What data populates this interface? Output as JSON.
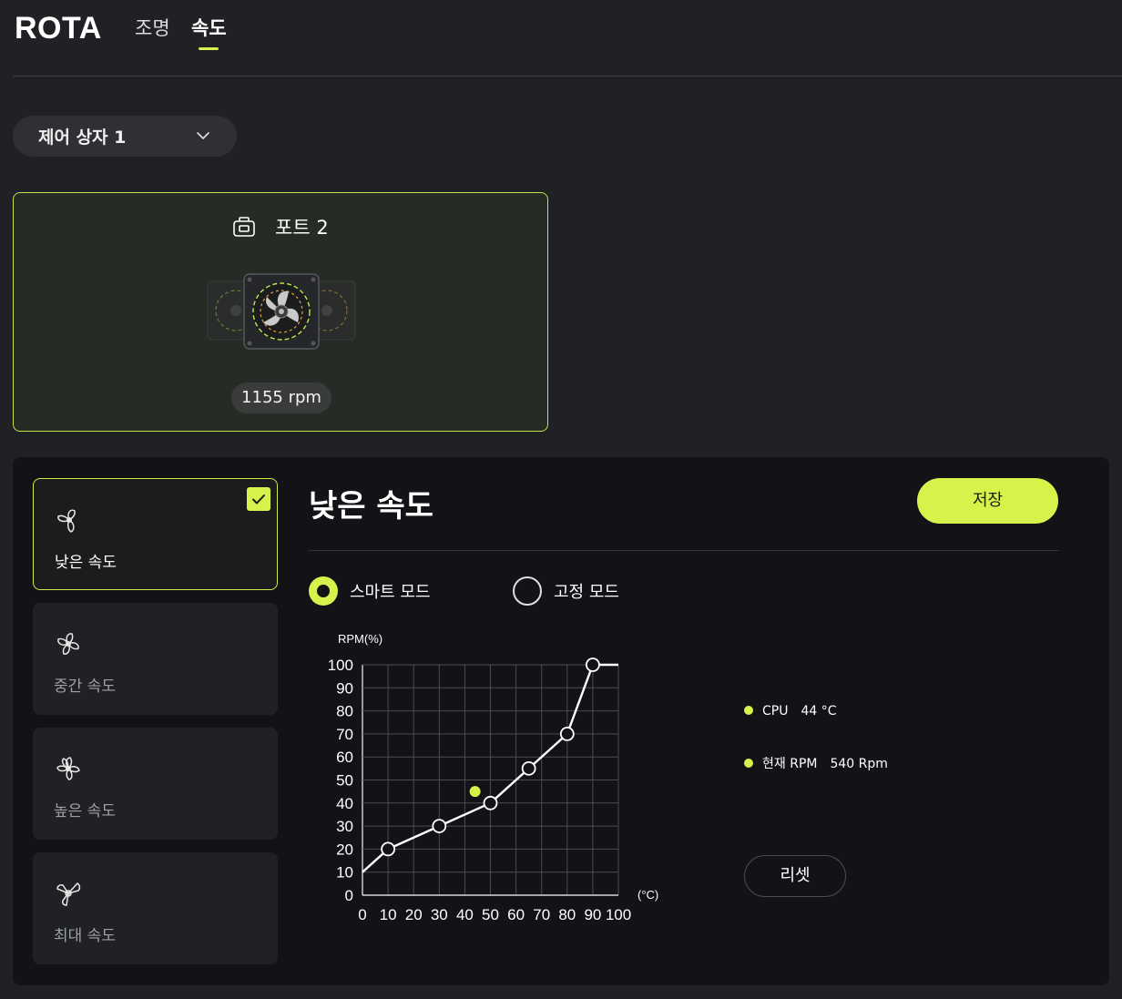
{
  "header": {
    "logo": "ROTA",
    "tabs": [
      {
        "label": "조명",
        "active": false
      },
      {
        "label": "속도",
        "active": true
      }
    ]
  },
  "controller_select": {
    "value": "제어 상자 1"
  },
  "port_card": {
    "title": "포트 2",
    "rpm": "1155 rpm"
  },
  "modes": [
    {
      "label": "낮은 속도",
      "selected": true,
      "icon": "fan-low-icon"
    },
    {
      "label": "중간 속도",
      "selected": false,
      "icon": "fan-medium-icon"
    },
    {
      "label": "높은 속도",
      "selected": false,
      "icon": "fan-high-icon"
    },
    {
      "label": "최대 속도",
      "selected": false,
      "icon": "fan-max-icon"
    }
  ],
  "detail": {
    "title": "낮은 속도",
    "save_label": "저장",
    "smart_mode_label": "스마트 모드",
    "fixed_mode_label": "고정 모드",
    "reset_label": "리셋"
  },
  "legend": {
    "cpu_label": "CPU",
    "cpu_value": "44 °C",
    "rpm_label": "현재 RPM",
    "rpm_value": "540 Rpm"
  },
  "colors": {
    "accent": "#d9f24b",
    "background": "#1f2124",
    "panel": "#111316"
  },
  "chart_data": {
    "type": "line",
    "ylabel": "RPM(%)",
    "xlabel": "(°C)",
    "x_ticks": [
      0,
      10,
      20,
      30,
      40,
      50,
      60,
      70,
      80,
      90,
      100
    ],
    "y_ticks": [
      0,
      10,
      20,
      30,
      40,
      50,
      60,
      70,
      80,
      90,
      100
    ],
    "xlim": [
      0,
      100
    ],
    "ylim": [
      0,
      100
    ],
    "grid": true,
    "curve": {
      "x": [
        0,
        10,
        30,
        50,
        65,
        80,
        90,
        100
      ],
      "y": [
        10,
        20,
        30,
        40,
        55,
        70,
        100,
        100
      ]
    },
    "control_points": {
      "x": [
        10,
        30,
        50,
        65,
        80,
        90
      ],
      "y": [
        20,
        30,
        40,
        55,
        70,
        100
      ]
    },
    "current_point": {
      "x": 44,
      "y": 45
    }
  }
}
